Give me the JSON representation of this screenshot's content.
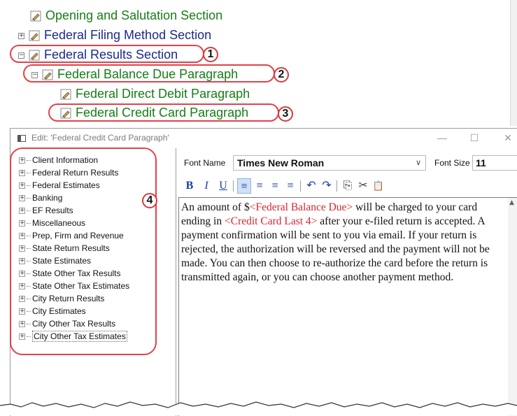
{
  "top_tree": {
    "items": [
      {
        "label": "Opening and Salutation Section",
        "expander": ""
      },
      {
        "label": "Federal Filing Method Section",
        "expander": "+"
      },
      {
        "label": "Federal Results Section",
        "expander": "−"
      },
      {
        "label": "Federal Balance Due Paragraph",
        "expander": "−"
      },
      {
        "label": "Federal Direct Debit Paragraph",
        "expander": ""
      },
      {
        "label": "Federal Credit Card Paragraph",
        "expander": ""
      }
    ]
  },
  "callouts": [
    "1",
    "2",
    "3",
    "4"
  ],
  "dialog": {
    "title": "Edit: 'Federal Credit Card Paragraph'",
    "minimize": "—",
    "maximize": "☐",
    "close": "✕",
    "left_tree": [
      "Client Information",
      "Federal Return Results",
      "Federal Estimates",
      "Banking",
      "EF Results",
      "Miscellaneous",
      "Prep, Firm and Revenue",
      "State Return Results",
      "State Estimates",
      "State Other Tax Results",
      "State Other Tax Estimates",
      "City Return Results",
      "City Estimates",
      "City Other Tax Results",
      "City Other Tax Estimates"
    ],
    "tree_expander": "+",
    "font_name_label": "Font Name",
    "font_name_value": "Times New Roman",
    "font_size_label": "Font Size",
    "font_size_value": "11",
    "toolbar": {
      "bold": "B",
      "italic": "I",
      "underline": "U",
      "align_left": "≡",
      "align_center": "≡",
      "align_right": "≡",
      "justify": "≡",
      "undo": "↶",
      "redo": "↷",
      "copy": "⎘",
      "cut": "✂",
      "paste": "📋"
    },
    "editor": {
      "t1": "An amount of $",
      "f1": "<Federal Balance Due>",
      "t2": " will be charged to your card ending in ",
      "f2": "<Credit Card Last 4>",
      "t3": " after your e-filed return is accepted. A payment confirmation will be sent to you via email. If your return is rejected, the authorization will be reversed and the payment will not be made. You can then choose to re-authorize the card before the return is transmitted again, or you can choose another payment method."
    }
  },
  "colors": {
    "green_text": "#177d17",
    "navy_text": "#1a2a8c",
    "callout_red": "#e0434a",
    "field_red": "#d8262e"
  }
}
